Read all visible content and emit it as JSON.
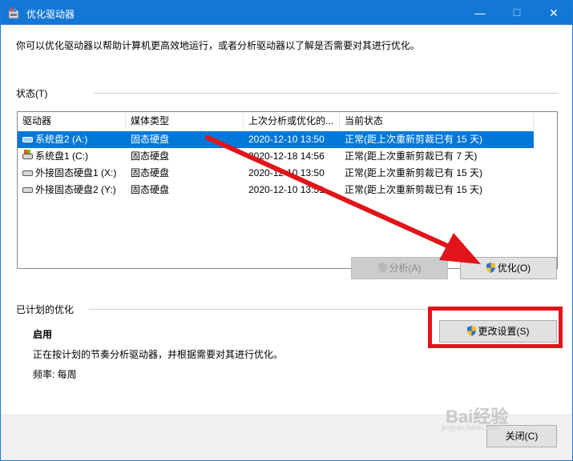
{
  "window": {
    "title": "优化驱动器",
    "minimize": "—",
    "maximize": "☐",
    "close": "✕"
  },
  "intro": "你可以优化驱动器以帮助计算机更高效地运行，或者分析驱动器以了解是否需要对其进行优化。",
  "status_section": {
    "label": "状态(T)"
  },
  "columns": [
    "驱动器",
    "媒体类型",
    "上次分析或优化的...",
    "当前状态"
  ],
  "drives": [
    {
      "name": "系统盘2 (A:)",
      "media": "固态硬盘",
      "last": "2020-12-10 13:50",
      "status": "正常(距上次重新剪裁已有 15 天)"
    },
    {
      "name": "系统盘1 (C:)",
      "media": "固态硬盘",
      "last": "2020-12-18 14:56",
      "status": "正常(距上次重新剪裁已有 7 天)"
    },
    {
      "name": "外接固态硬盘1 (X:)",
      "media": "固态硬盘",
      "last": "2020-12-10 13:50",
      "status": "正常(距上次重新剪裁已有 15 天)"
    },
    {
      "name": "外接固态硬盘2 (Y:)",
      "media": "固态硬盘",
      "last": "2020-12-10 13:51",
      "status": "正常(距上次重新剪裁已有 15 天)"
    }
  ],
  "buttons": {
    "analyze": "分析(A)",
    "optimize": "优化(O)",
    "change_settings": "更改设置(S)",
    "close": "关闭(C)"
  },
  "scheduled": {
    "label": "已计划的优化",
    "state": "启用",
    "description": "正在按计划的节奏分析驱动器，并根据需要对其进行优化。",
    "frequency": "频率: 每周"
  },
  "watermark": {
    "text": "Bai经验",
    "sub": "jingyan.baidu.com"
  },
  "colors": {
    "accent": "#0078d7",
    "titlebar": "#1377d6",
    "annotation_red": "#e0141a"
  }
}
